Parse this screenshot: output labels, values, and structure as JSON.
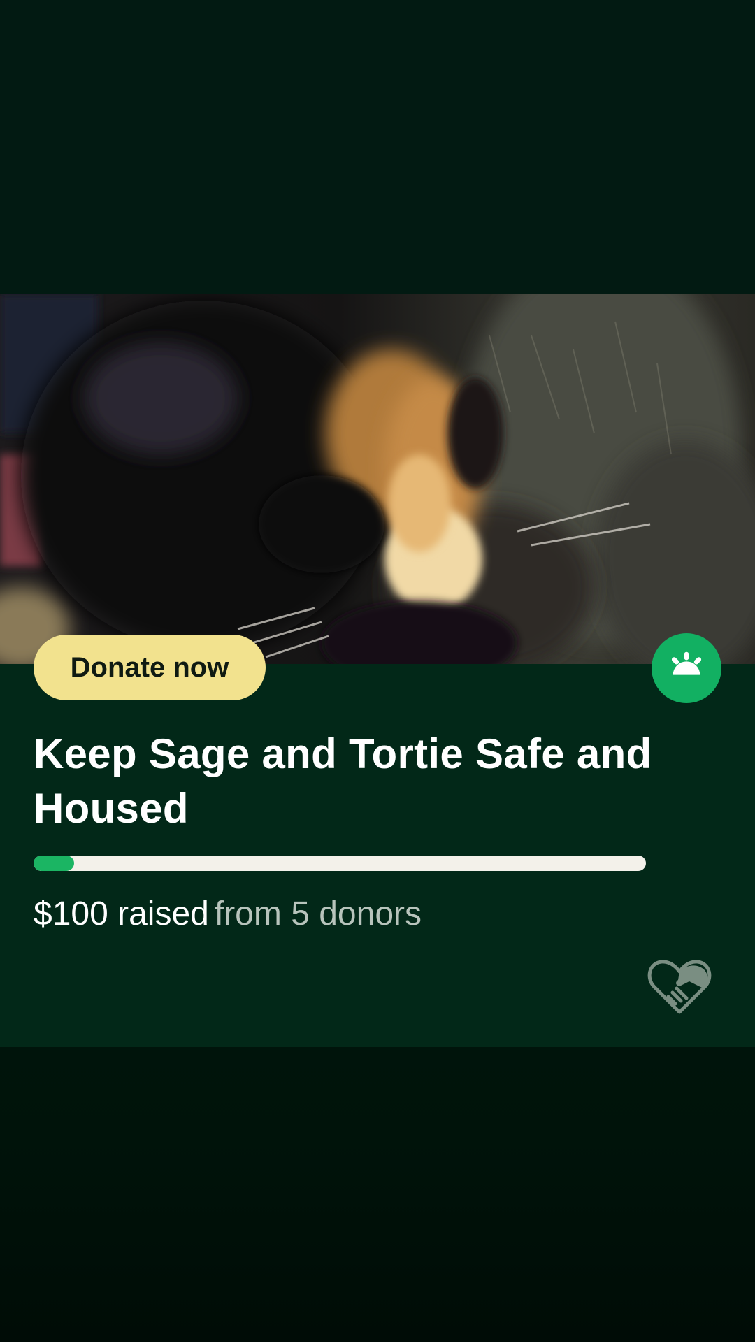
{
  "fundraiser": {
    "donate_label": "Donate now",
    "title": "Keep Sage and Tortie Safe and Housed",
    "amount_raised_text": "$100 raised",
    "donors_text": "from 5 donors",
    "progress_fraction": 0.066
  },
  "icons": {
    "logo": "gofundme-sunrise-icon",
    "heart": "heart-handshake-icon"
  },
  "colors": {
    "background": "#021a10",
    "panel": "#022818",
    "donate_button": "#f2e28e",
    "accent_green": "#12b062",
    "progress_track": "#f3f1ea",
    "progress_fill": "#1bb563"
  }
}
